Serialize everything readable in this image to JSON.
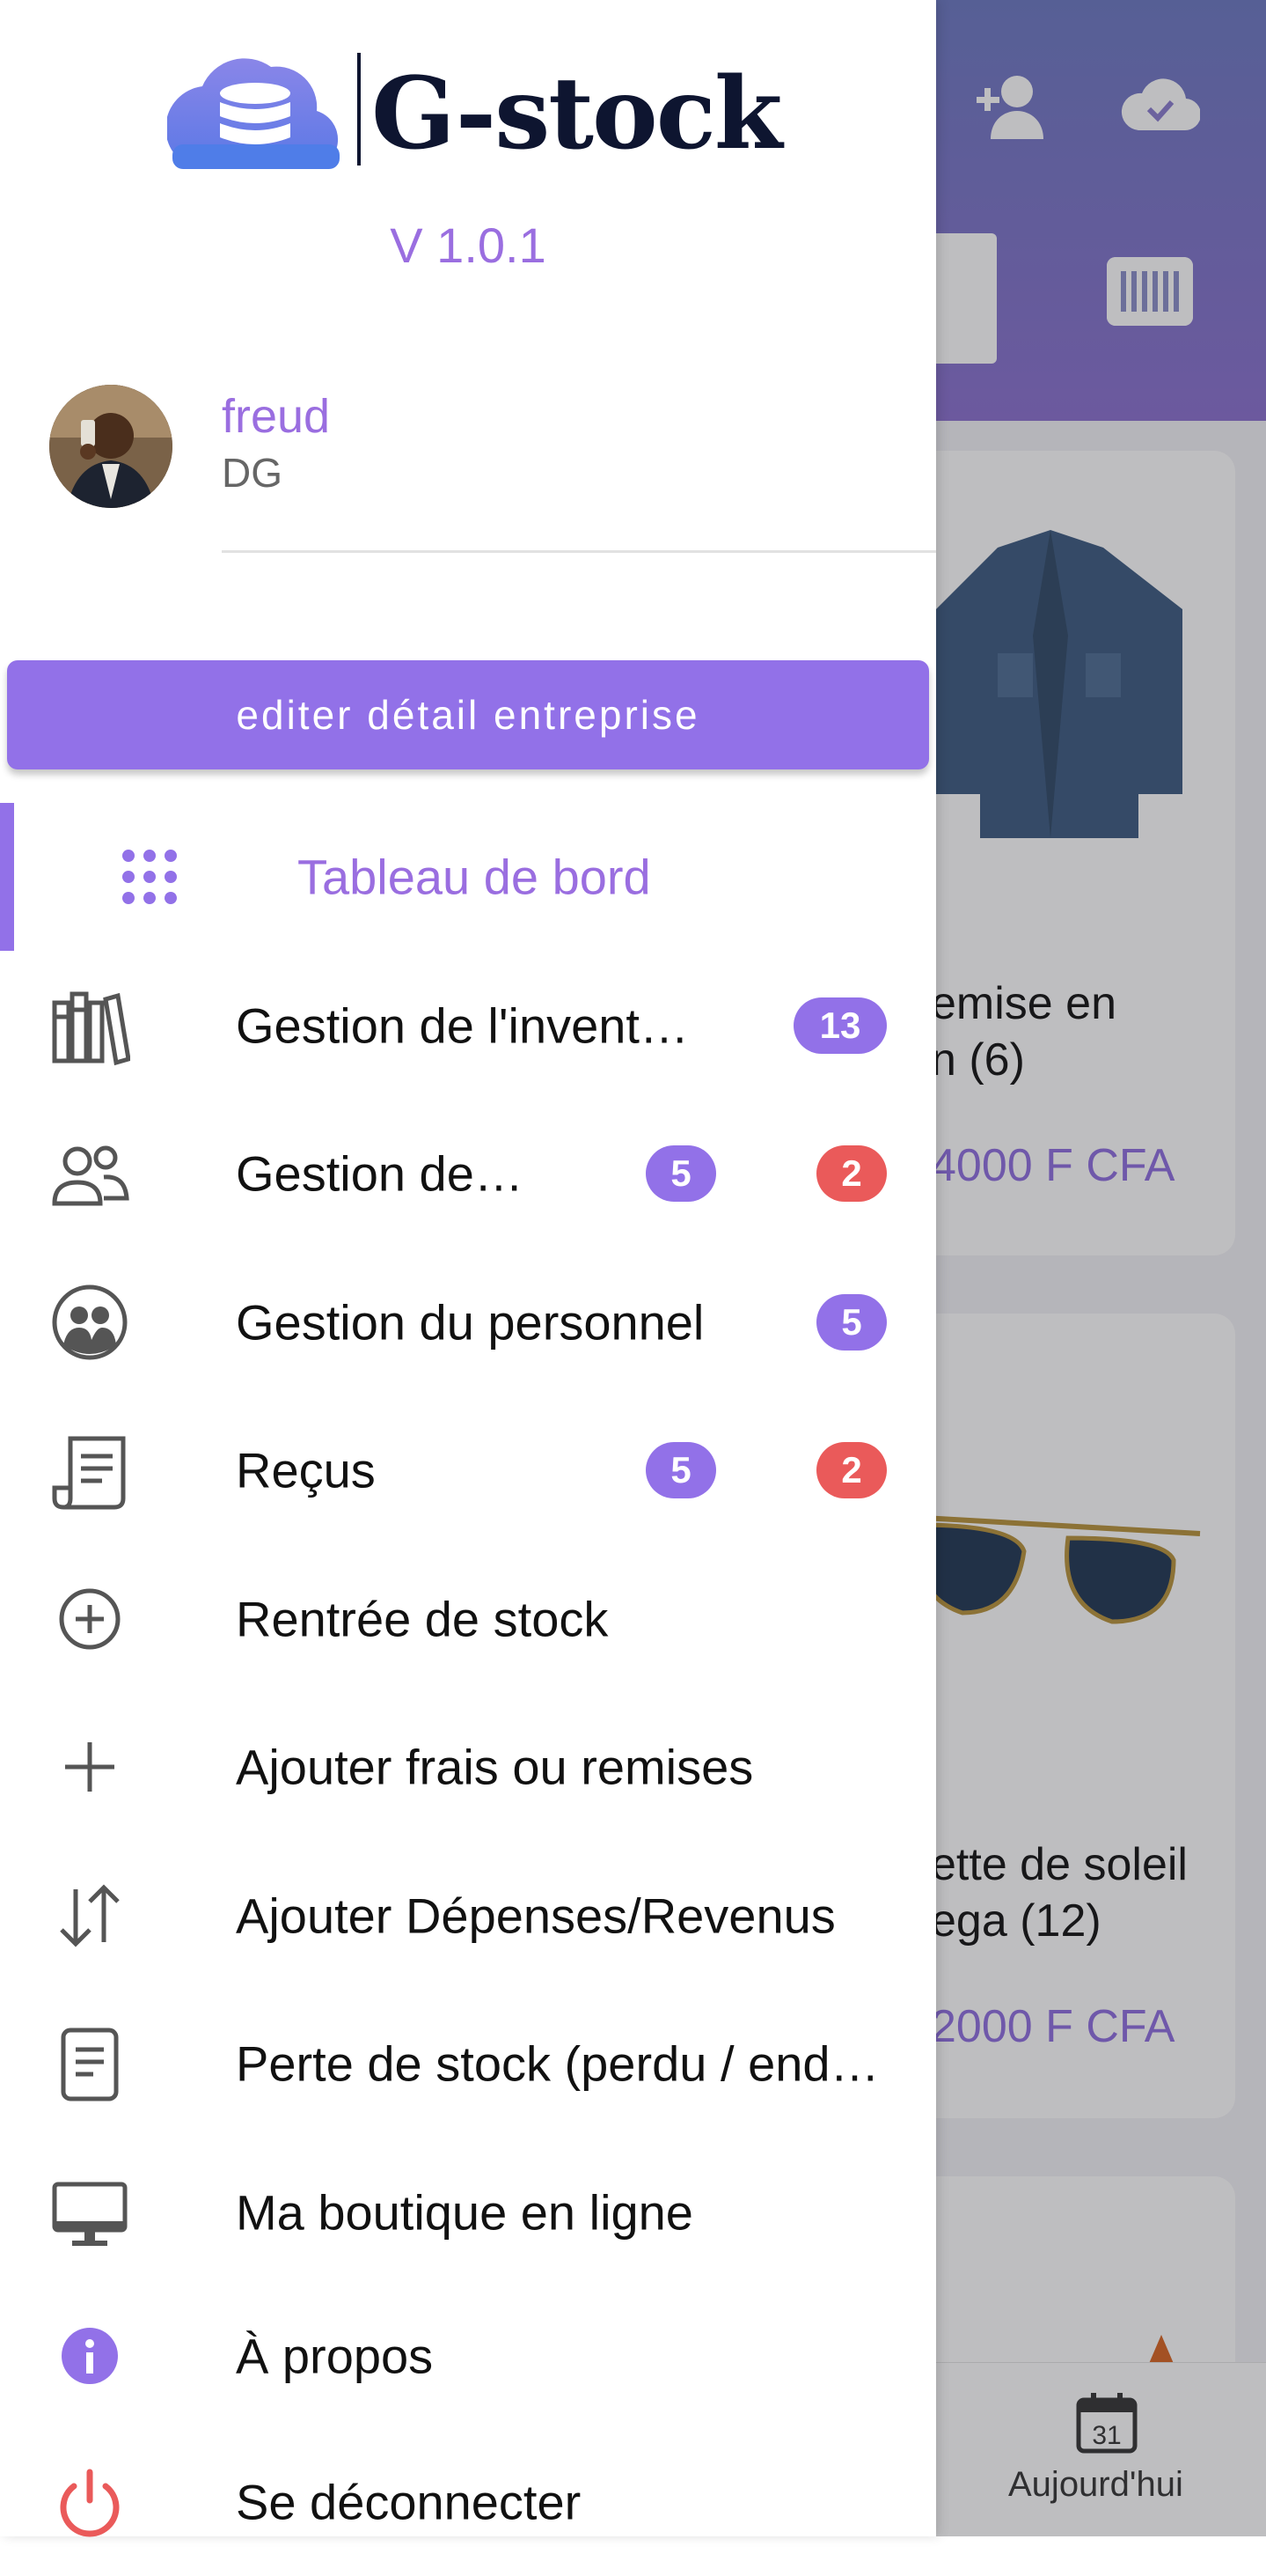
{
  "app": {
    "name": "G-stock",
    "version": "V 1.0.1"
  },
  "user": {
    "name": "freud",
    "role": "DG"
  },
  "edit_button": "editer détail entreprise",
  "menu": {
    "dashboard": "Tableau de bord",
    "inventory": {
      "label": "Gestion de l'invent…",
      "badge": "13"
    },
    "clients": {
      "label": "Gestion de…",
      "badge1": "5",
      "badge2": "2"
    },
    "staff": {
      "label": "Gestion du personnel",
      "badge": "5"
    },
    "receipts": {
      "label": "Reçus",
      "badge1": "5",
      "badge2": "2"
    },
    "stock_in": "Rentrée de stock",
    "fees": "Ajouter frais ou remises",
    "expenses": "Ajouter Dépenses/Revenus",
    "stock_loss": "Perte de stock (perdu / end…",
    "online_shop": "Ma boutique en ligne",
    "about": "À propos",
    "logout": "Se déconnecter"
  },
  "background": {
    "card1": {
      "name": "emise en\nn (6)",
      "price": "4000 F CFA"
    },
    "card2": {
      "name": "ette de soleil\nega (12)",
      "price": "2000 F CFA"
    },
    "bottom_nav": {
      "today_label": "Aujourd'hui",
      "today_day": "31"
    }
  },
  "colors": {
    "accent": "#9271e8",
    "accent_text": "#9a6ee0",
    "badge_red": "#ea5a5a",
    "logo_dark": "#0e1530"
  }
}
